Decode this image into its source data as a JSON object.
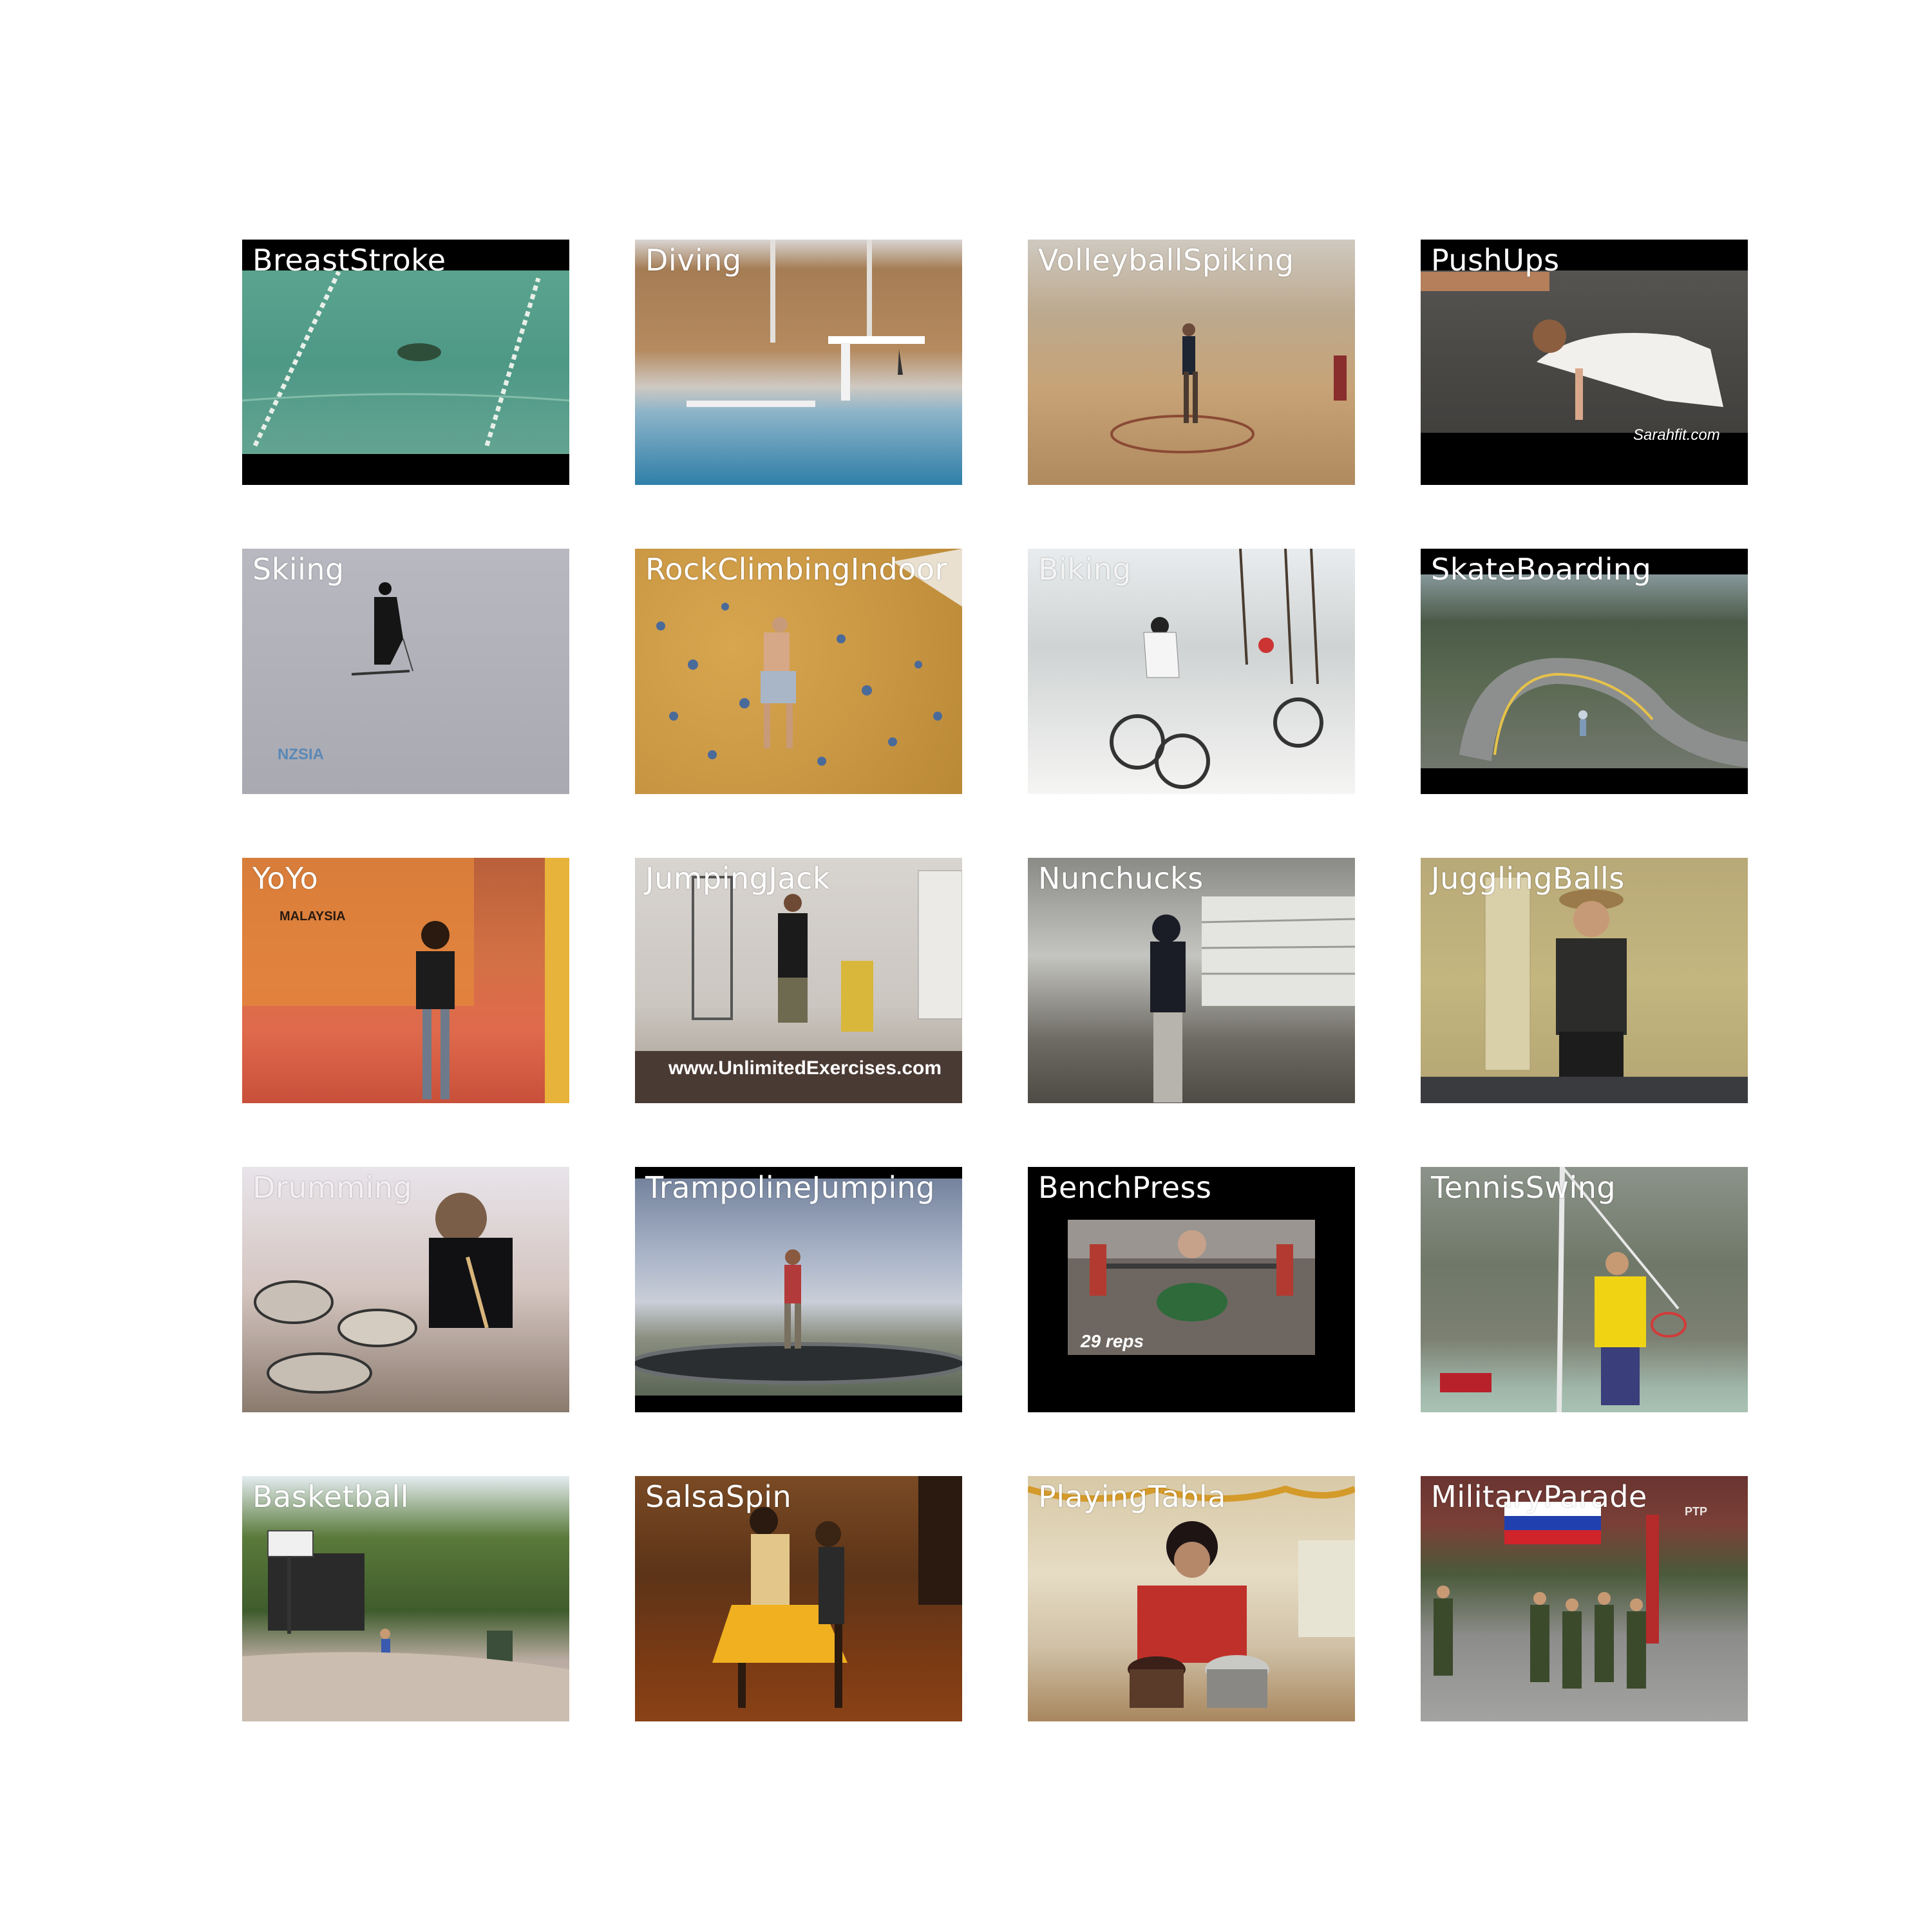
{
  "grid": {
    "tiles": [
      {
        "label": "BreastStroke",
        "scene": "swimming-pool-lanes"
      },
      {
        "label": "Diving",
        "scene": "diving-board-pool"
      },
      {
        "label": "VolleyballSpiking",
        "scene": "gym-volleyball"
      },
      {
        "label": "PushUps",
        "scene": "gym-pushups",
        "watermark": "Sarahfit.com"
      },
      {
        "label": "Skiing",
        "scene": "snow-slope",
        "watermark": "NZSIA"
      },
      {
        "label": "RockClimbingIndoor",
        "scene": "climbing-wall"
      },
      {
        "label": "Biking",
        "scene": "trail-bikes"
      },
      {
        "label": "SkateBoarding",
        "scene": "mountain-road"
      },
      {
        "label": "YoYo",
        "scene": "stage-yoyo",
        "watermark": "MALAYSIA"
      },
      {
        "label": "JumpingJack",
        "scene": "hallway-exercise",
        "watermark": "www.UnlimitedExercises.com"
      },
      {
        "label": "Nunchucks",
        "scene": "garage"
      },
      {
        "label": "JugglingBalls",
        "scene": "room-juggling"
      },
      {
        "label": "Drumming",
        "scene": "drum-kit"
      },
      {
        "label": "TrampolineJumping",
        "scene": "trampoline-sky"
      },
      {
        "label": "BenchPress",
        "scene": "gym-bench",
        "watermark": "29 reps"
      },
      {
        "label": "TennisSwing",
        "scene": "tennis-court"
      },
      {
        "label": "Basketball",
        "scene": "backyard-hoop"
      },
      {
        "label": "SalsaSpin",
        "scene": "dance-hall"
      },
      {
        "label": "PlayingTabla",
        "scene": "tabla-room"
      },
      {
        "label": "MilitaryParade",
        "scene": "parade-flag",
        "watermark": "PTP"
      }
    ]
  },
  "colors": {
    "label_text": "#ffffff",
    "letterbox": "#000000",
    "background": "#ffffff"
  }
}
